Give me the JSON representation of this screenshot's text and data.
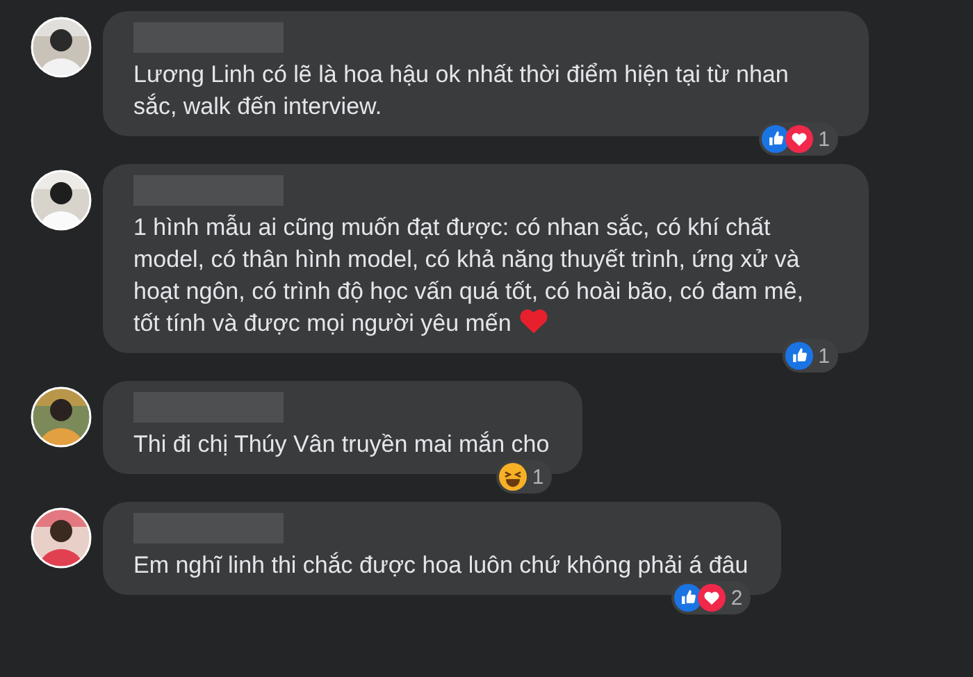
{
  "comments": [
    {
      "text": "Lương Linh có lẽ là hoa hậu ok nhất thời điểm hiện tại từ nhan sắc, walk đến interview.",
      "heart": false,
      "reactions": [
        {
          "kind": "like"
        },
        {
          "kind": "love"
        }
      ],
      "count": "1"
    },
    {
      "text": "1 hình mẫu ai cũng muốn đạt được: có nhan sắc, có khí chất model, có thân hình model, có khả năng thuyết trình, ứng xử và hoạt ngôn, có trình độ học vấn quá tốt, có hoài bão, có đam mê, tốt tính và được mọi người yêu mến",
      "heart": true,
      "reactions": [
        {
          "kind": "like"
        }
      ],
      "count": "1"
    },
    {
      "text": "Thi đi chị Thúy Vân truyền mai mắn cho",
      "heart": false,
      "reactions": [
        {
          "kind": "haha"
        }
      ],
      "count": "1"
    },
    {
      "text": "Em nghĩ linh thi chắc được hoa luôn chứ không phải á đâu",
      "heart": false,
      "reactions": [
        {
          "kind": "like"
        },
        {
          "kind": "love"
        }
      ],
      "count": "2"
    }
  ]
}
